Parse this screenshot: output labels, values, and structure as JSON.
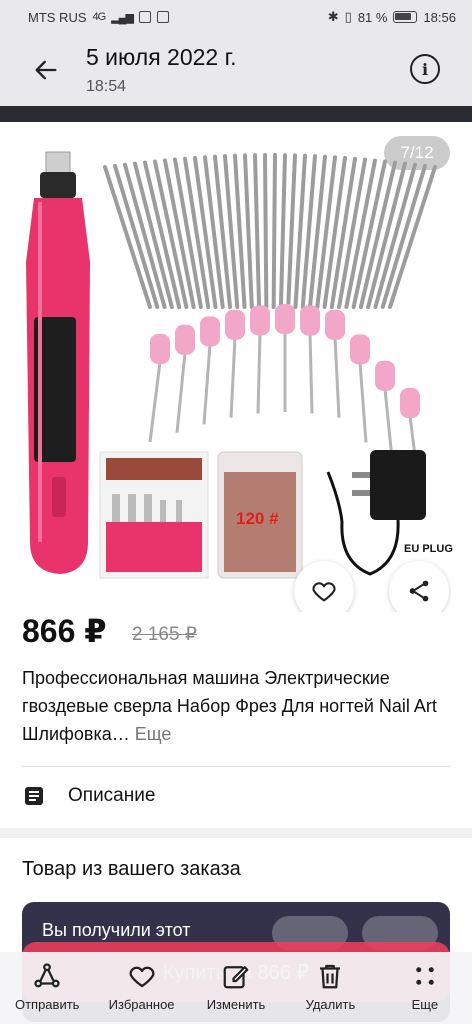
{
  "status_bar": {
    "carrier": "MTS RUS",
    "network": "4G",
    "battery": "81 %",
    "time": "18:56"
  },
  "header": {
    "title": "5 июля 2022 г.",
    "subtitle": "18:54",
    "back_icon": "arrow-left-icon",
    "info_icon": "info-icon"
  },
  "product": {
    "image_counter": "7/12",
    "image_texts": [
      "120 #",
      "EU PLUG"
    ],
    "price": "866 ₽",
    "old_price": "2 165 ₽",
    "description": "Профессиональная машина Электрические гвоздевые сверла Набор Фрез Для ногтей Nail Art Шлифовка…",
    "more_label": "Еще",
    "description_row_label": "Описание"
  },
  "order": {
    "title": "Товар из вашего заказа",
    "card_text": "Вы получили этот",
    "buy_label": "Купить за 866 ₽"
  },
  "bottom_bar": {
    "items": [
      {
        "label": "Отправить",
        "icon": "send-icon"
      },
      {
        "label": "Избранное",
        "icon": "heart-icon"
      },
      {
        "label": "Изменить",
        "icon": "edit-icon"
      },
      {
        "label": "Удалить",
        "icon": "trash-icon"
      },
      {
        "label": "Еще",
        "icon": "more-icon"
      }
    ]
  },
  "colors": {
    "accent": "#f33d5c",
    "dark_card": "#33324a",
    "pen_pink": "#e8346b"
  }
}
